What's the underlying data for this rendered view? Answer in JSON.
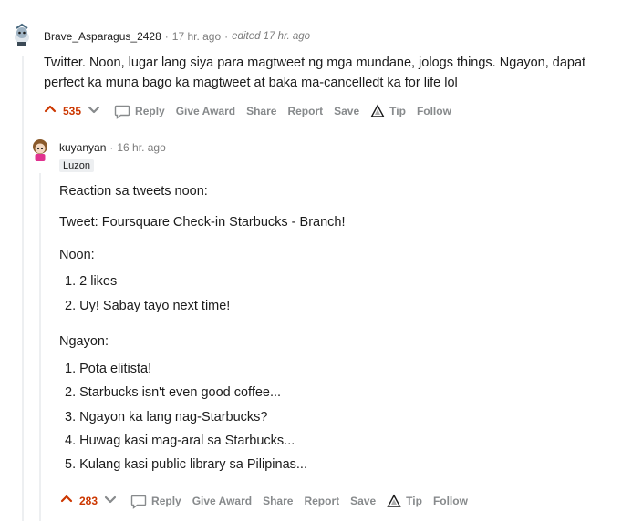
{
  "comments": [
    {
      "author": "Brave_Asparagus_2428",
      "time": "17 hr. ago",
      "edited": "edited 17 hr. ago",
      "avatar_icon": "snoo-avatar-icon",
      "body": "Twitter. Noon, lugar lang siya para magtweet ng mga mundane, jologs things. Ngayon, dapat perfect ka muna bago ka magtweet at baka ma-cancelledt ka for life lol",
      "score": "535"
    },
    {
      "author": "kuyanyan",
      "time": "16 hr. ago",
      "flair": "Luzon",
      "avatar_icon": "snoo-avatar-pink-icon",
      "lines": [
        "Reaction sa tweets noon:",
        "Tweet: Foursquare Check-in Starbucks - Branch!",
        "Noon:"
      ],
      "noon_list": [
        "2 likes",
        "Uy! Sabay tayo next time!"
      ],
      "ngayon_heading": "Ngayon:",
      "ngayon_list": [
        "Pota elitista!",
        "Starbucks isn't even good coffee...",
        "Ngayon ka lang nag-Starbucks?",
        "Huwag kasi mag-aral sa Starbucks...",
        "Kulang kasi public library sa Pilipinas..."
      ],
      "score": "283"
    }
  ],
  "actions": {
    "reply": "Reply",
    "give_award": "Give Award",
    "share": "Share",
    "report": "Report",
    "save": "Save",
    "tip": "Tip",
    "follow": "Follow"
  },
  "separator": "·",
  "colors": {
    "upvote": "#cc3700",
    "muted": "#878a8c",
    "thread_line": "#edeff1"
  }
}
